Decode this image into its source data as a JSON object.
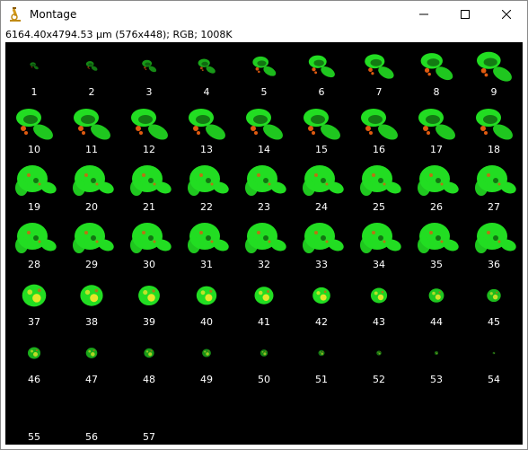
{
  "window": {
    "title": "Montage",
    "info": "6164.40x4794.53 µm (576x448); RGB; 1008K",
    "icon": "microscope-icon",
    "controls": [
      "minimize-icon",
      "maximize-icon",
      "close-icon"
    ]
  },
  "montage": {
    "columns": 9,
    "rows": 7,
    "labels": [
      "1",
      "2",
      "3",
      "4",
      "5",
      "6",
      "7",
      "8",
      "9",
      "10",
      "11",
      "12",
      "13",
      "14",
      "15",
      "16",
      "17",
      "18",
      "19",
      "20",
      "21",
      "22",
      "23",
      "24",
      "25",
      "26",
      "27",
      "28",
      "29",
      "30",
      "31",
      "32",
      "33",
      "34",
      "35",
      "36",
      "37",
      "38",
      "39",
      "40",
      "41",
      "42",
      "43",
      "44",
      "45",
      "46",
      "47",
      "48",
      "49",
      "50",
      "51",
      "52",
      "53",
      "54",
      "55",
      "56",
      "57"
    ]
  },
  "colors": {
    "background": "#000000",
    "label": "#ffffff",
    "green_signal": "#22dd22",
    "orange_signal": "#e05a10",
    "yellow_signal": "#e6e62a"
  }
}
